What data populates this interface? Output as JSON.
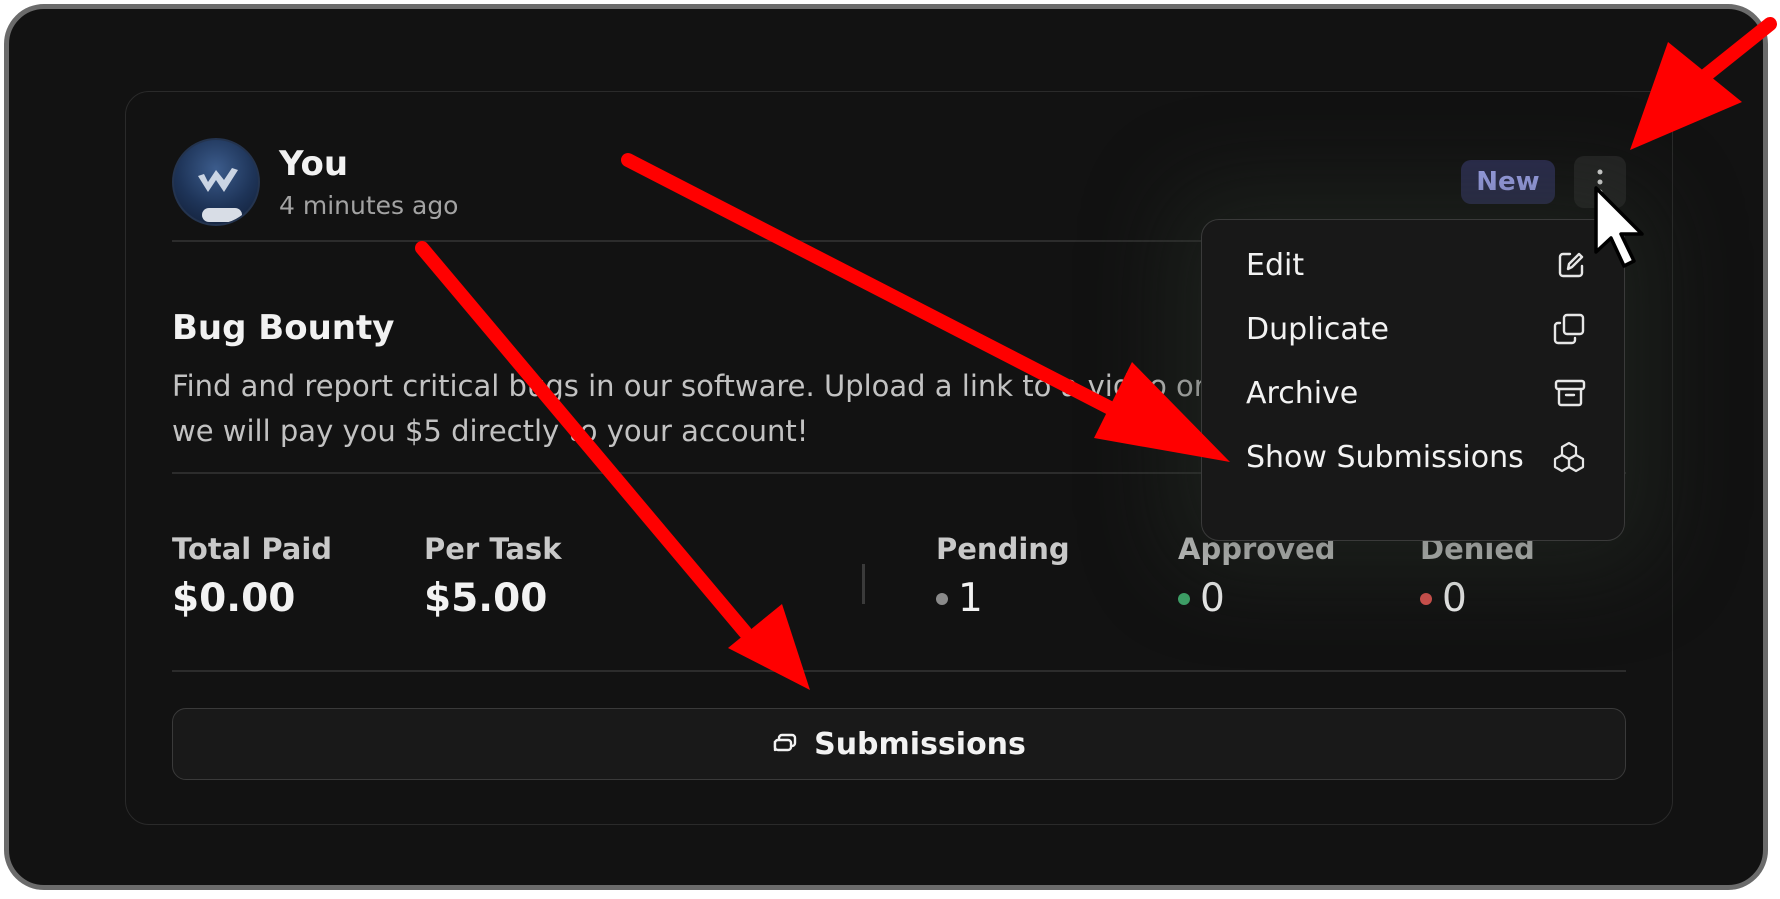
{
  "author": {
    "name": "You",
    "time": "4 minutes ago"
  },
  "badge": {
    "label": "New"
  },
  "task": {
    "title": "Bug Bounty",
    "description_line1": "Find and report critical bugs in our software. Upload a link to a video or",
    "description_line2": "we will pay you $5 directly to your account!"
  },
  "stats": {
    "total_paid_label": "Total Paid",
    "total_paid_value": "$0.00",
    "per_task_label": "Per Task",
    "per_task_value": "$5.00",
    "pending_label": "Pending",
    "pending_value": "1",
    "approved_label": "Approved",
    "approved_value": "0",
    "denied_label": "Denied",
    "denied_value": "0"
  },
  "status_colors": {
    "pending": "#8a8a8a",
    "approved": "#3fa56a",
    "denied": "#d9534f"
  },
  "submissions_button": {
    "label": "Submissions",
    "icon": "chat-bubbles-icon"
  },
  "menu": {
    "items": [
      {
        "label": "Edit",
        "icon": "edit-icon"
      },
      {
        "label": "Duplicate",
        "icon": "duplicate-icon"
      },
      {
        "label": "Archive",
        "icon": "archive-icon"
      },
      {
        "label": "Show Submissions",
        "icon": "cubes-icon"
      }
    ]
  },
  "annotations": {
    "arrow_color": "#ff0000"
  }
}
